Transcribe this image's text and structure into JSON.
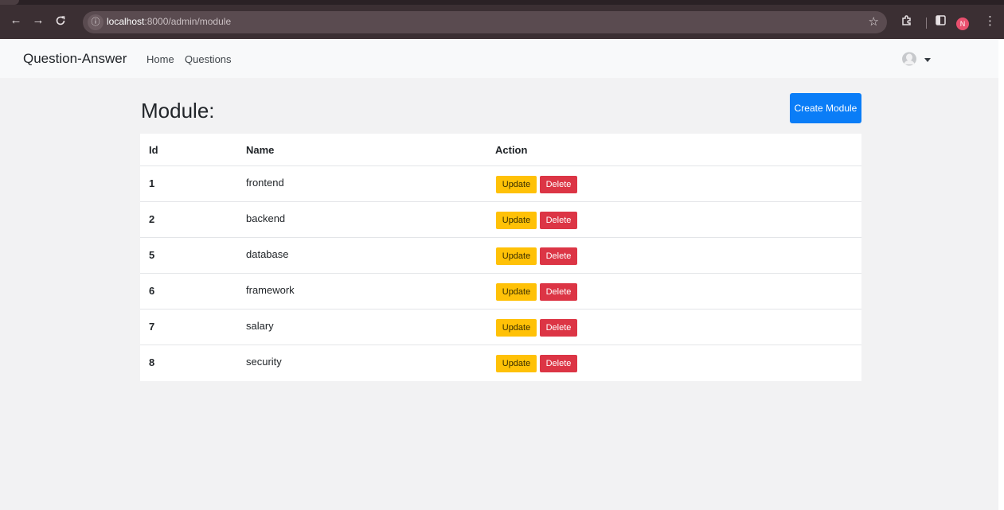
{
  "browser": {
    "url_host": "localhost",
    "url_path": ":8000/admin/module",
    "profile_initial": "N",
    "icons": [
      "back-arrow-icon",
      "forward-arrow-icon",
      "reload-icon",
      "info-icon",
      "star-icon",
      "extensions-icon",
      "side-panel-icon",
      "menu-dots-icon"
    ]
  },
  "navbar": {
    "brand": "Question-Answer",
    "links": [
      "Home",
      "Questions"
    ]
  },
  "page": {
    "heading": "Module:",
    "create_label": "Create Module"
  },
  "table": {
    "headers": [
      "Id",
      "Name",
      "Action"
    ],
    "rows": [
      {
        "id": "1",
        "name": "frontend"
      },
      {
        "id": "2",
        "name": "backend"
      },
      {
        "id": "5",
        "name": "database"
      },
      {
        "id": "6",
        "name": "framework"
      },
      {
        "id": "7",
        "name": "salary"
      },
      {
        "id": "8",
        "name": "security"
      }
    ],
    "update_label": "Update",
    "delete_label": "Delete"
  },
  "colors": {
    "primary": "#0a7df7",
    "warning": "#ffc107",
    "danger": "#dc3545",
    "chrome": "#3b2f33"
  }
}
